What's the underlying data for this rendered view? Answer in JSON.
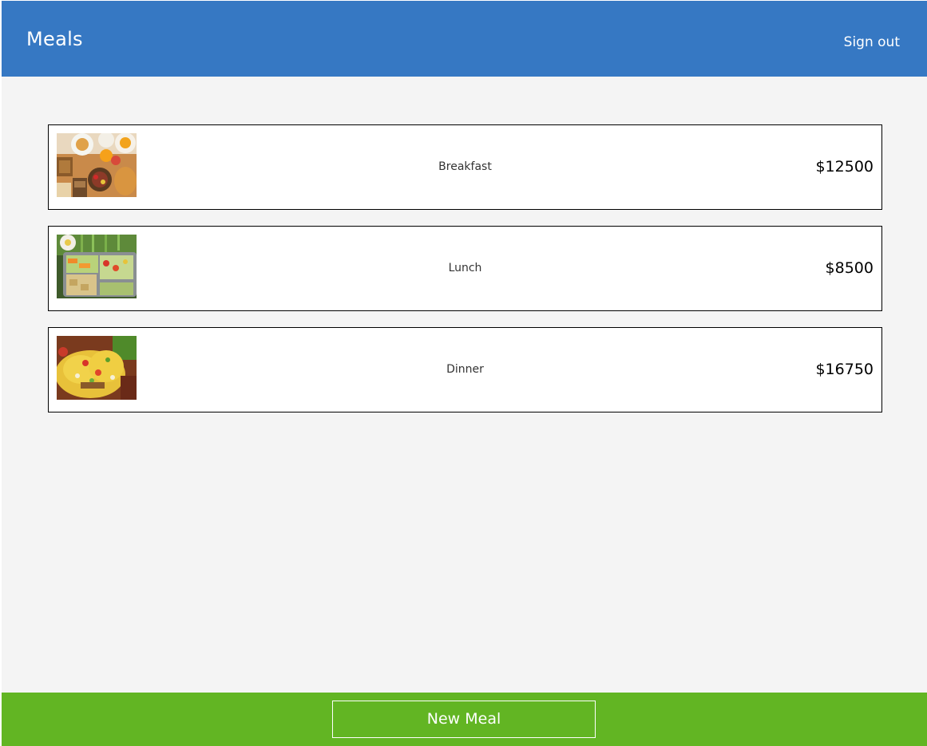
{
  "header": {
    "title": "Meals",
    "signout_label": "Sign out"
  },
  "meals": [
    {
      "name": "Breakfast",
      "price": "$12500",
      "image": "breakfast-photo"
    },
    {
      "name": "Lunch",
      "price": "$8500",
      "image": "lunch-photo"
    },
    {
      "name": "Dinner",
      "price": "$16750",
      "image": "dinner-photo"
    }
  ],
  "footer": {
    "new_meal_label": "New Meal"
  },
  "colors": {
    "header": "#3678c3",
    "footer": "#62b523",
    "background": "#f4f4f4"
  }
}
